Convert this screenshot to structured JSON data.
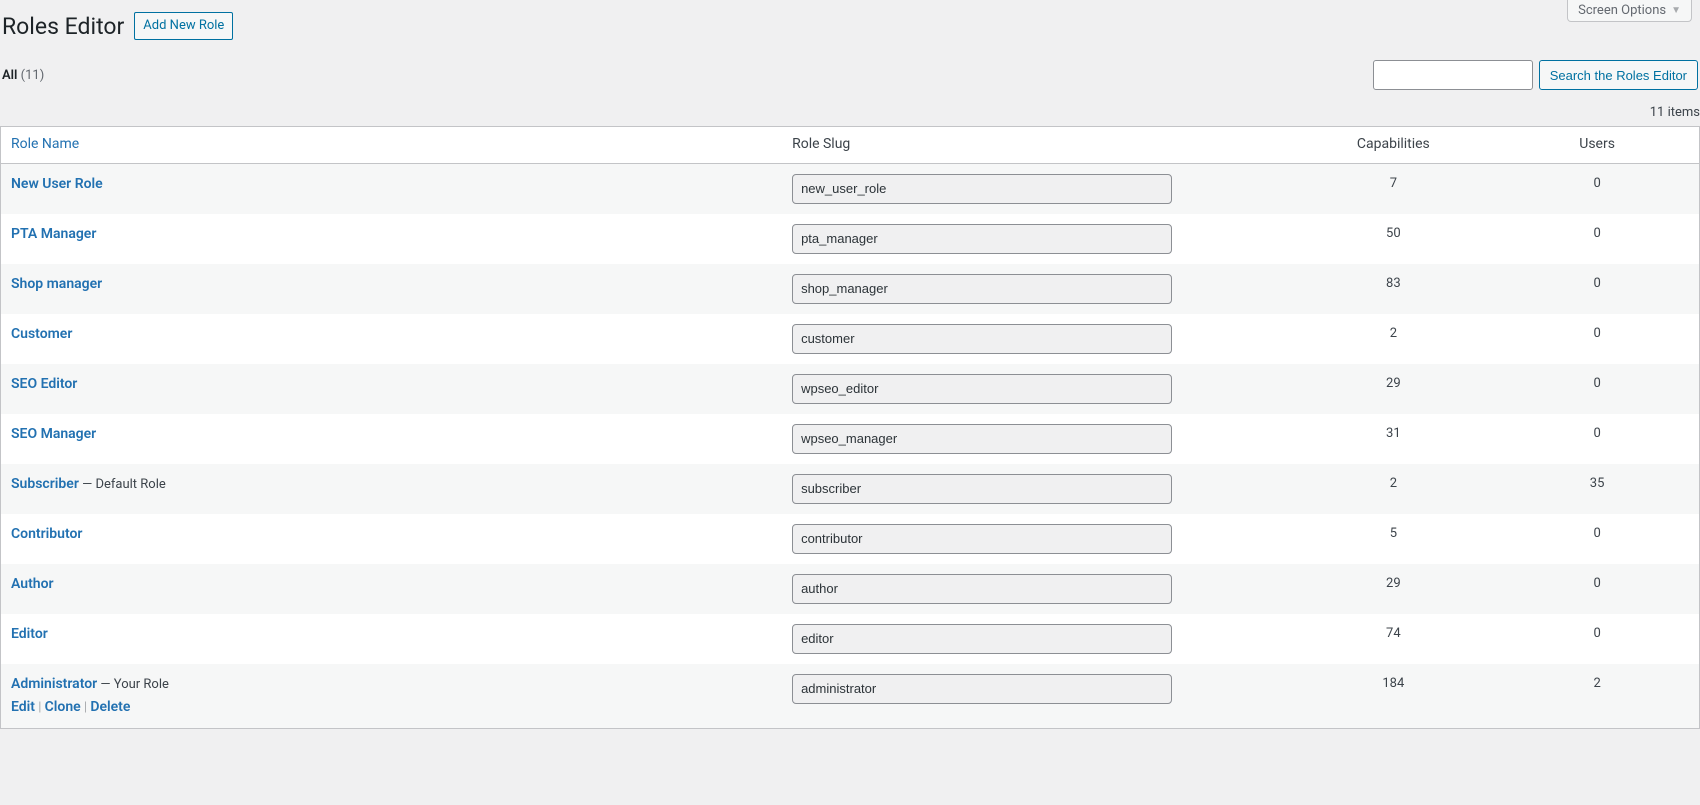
{
  "screen_options_label": "Screen Options",
  "page_title": "Roles Editor",
  "add_new_label": "Add New Role",
  "filter": {
    "all_label": "All",
    "all_count": "(11)"
  },
  "search_button": "Search the Roles Editor",
  "items_count_text": "11 items",
  "columns": {
    "name": "Role Name",
    "slug": "Role Slug",
    "caps": "Capabilities",
    "users": "Users"
  },
  "row_actions": {
    "edit": "Edit",
    "clone": "Clone",
    "delete": "Delete",
    "sep": " | "
  },
  "roles": [
    {
      "name": "New User Role",
      "suffix": "",
      "slug": "new_user_role",
      "caps": "7",
      "users": "0"
    },
    {
      "name": "PTA Manager",
      "suffix": "",
      "slug": "pta_manager",
      "caps": "50",
      "users": "0"
    },
    {
      "name": "Shop manager",
      "suffix": "",
      "slug": "shop_manager",
      "caps": "83",
      "users": "0"
    },
    {
      "name": "Customer",
      "suffix": "",
      "slug": "customer",
      "caps": "2",
      "users": "0"
    },
    {
      "name": "SEO Editor",
      "suffix": "",
      "slug": "wpseo_editor",
      "caps": "29",
      "users": "0"
    },
    {
      "name": "SEO Manager",
      "suffix": "",
      "slug": "wpseo_manager",
      "caps": "31",
      "users": "0"
    },
    {
      "name": "Subscriber",
      "suffix": " — Default Role",
      "slug": "subscriber",
      "caps": "2",
      "users": "35"
    },
    {
      "name": "Contributor",
      "suffix": "",
      "slug": "contributor",
      "caps": "5",
      "users": "0"
    },
    {
      "name": "Author",
      "suffix": "",
      "slug": "author",
      "caps": "29",
      "users": "0"
    },
    {
      "name": "Editor",
      "suffix": "",
      "slug": "editor",
      "caps": "74",
      "users": "0"
    },
    {
      "name": "Administrator",
      "suffix": " — Your Role",
      "slug": "administrator",
      "caps": "184",
      "users": "2"
    }
  ]
}
